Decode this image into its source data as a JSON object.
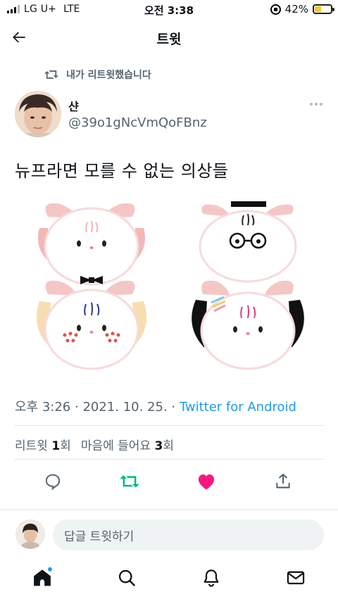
{
  "status_bar": {
    "carrier": "LG U+",
    "network": "LTE",
    "time": "오전 3:38",
    "battery_percent": "42%",
    "battery_level": 0.42
  },
  "header": {
    "title": "트윗"
  },
  "retweet_context": "내가 리트윗했습니다",
  "tweet": {
    "author_name": "샨",
    "author_handle": "@39o1gNcVmQoFBnz",
    "text": "뉴프라면 모를 수 없는 의상들",
    "time": "오후 3:26",
    "date": "2021. 10. 25.",
    "source": "Twitter for Android",
    "separator": " · "
  },
  "stats": {
    "retweets_label": "리트윗",
    "retweets_count": "1",
    "retweets_unit": "회",
    "likes_label": "마음에 들어요",
    "likes_count": "3",
    "likes_unit": "회"
  },
  "reply": {
    "placeholder": "답글 트윗하기"
  },
  "colors": {
    "accent": "#1d9bf0",
    "retweet": "#00ba7c",
    "like": "#f91880",
    "secondary_text": "#536471"
  }
}
